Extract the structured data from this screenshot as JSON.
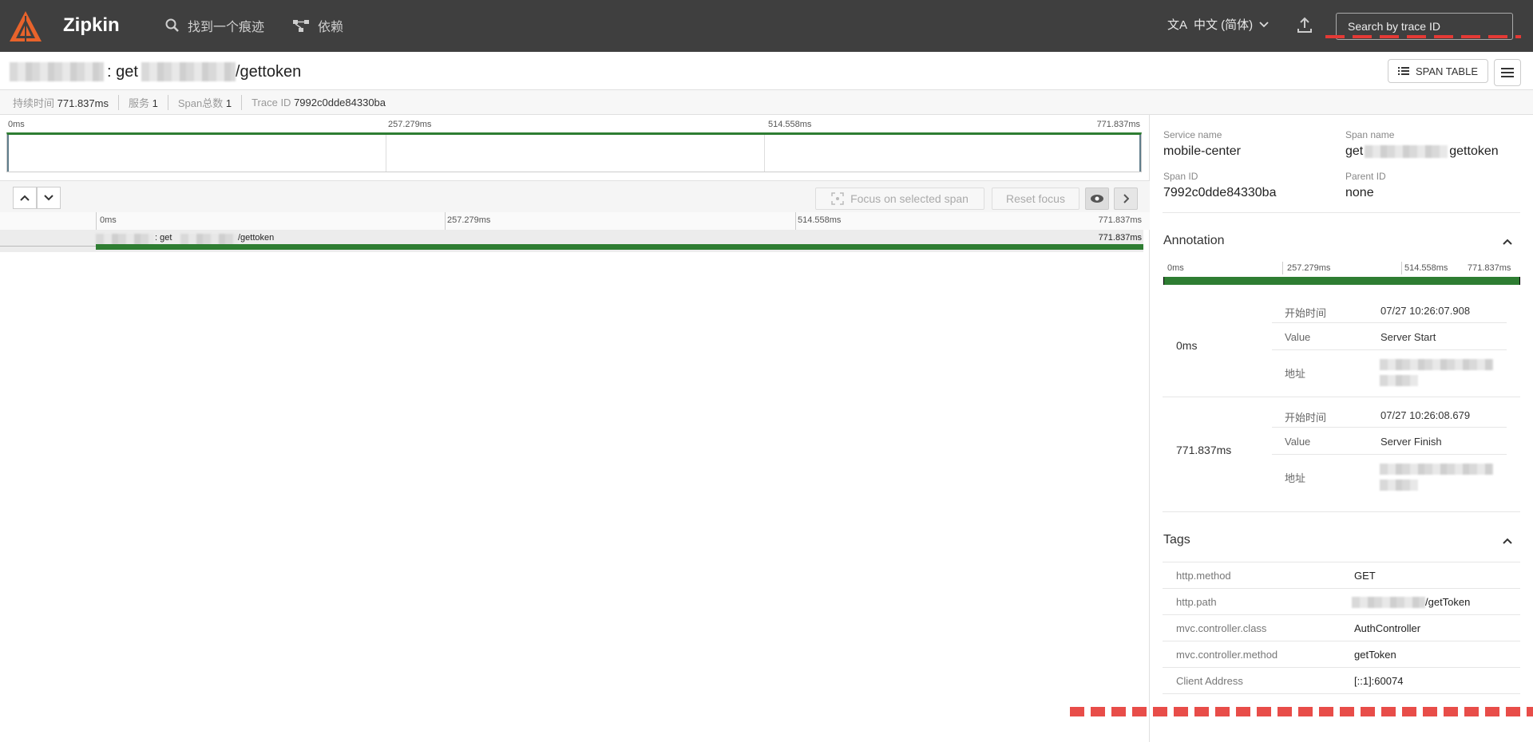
{
  "header": {
    "brand": "Zipkin",
    "nav": [
      {
        "label": "找到一个痕迹",
        "icon": "search-icon"
      },
      {
        "label": "依赖",
        "icon": "dependencies-icon"
      }
    ],
    "language": "中文 (简体)",
    "search_placeholder": "Search by trace ID"
  },
  "trace": {
    "title_mid": ": get",
    "title_end": "/gettoken",
    "span_table_label": "SPAN TABLE",
    "summary": {
      "duration_label": "持续时间",
      "duration_value": "771.837ms",
      "services_label": "服务",
      "services_value": "1",
      "spans_label": "Span总数",
      "spans_value": "1",
      "traceid_label": "Trace ID",
      "traceid_value": "7992c0dde84330ba"
    }
  },
  "timeline": {
    "ticks": [
      "0ms",
      "257.279ms",
      "514.558ms",
      "771.837ms"
    ],
    "focus_label": "Focus on selected span",
    "reset_label": "Reset focus",
    "span": {
      "name_mid": ": get",
      "name_end": "/gettoken",
      "duration": "771.837ms"
    }
  },
  "detail": {
    "service_name_label": "Service name",
    "service_name": "mobile-center",
    "span_name_label": "Span name",
    "span_name_prefix": "get",
    "span_name_suffix": "gettoken",
    "span_id_label": "Span ID",
    "span_id": "7992c0dde84330ba",
    "parent_id_label": "Parent ID",
    "parent_id": "none",
    "annotation_title": "Annotation",
    "annotation_ticks": [
      "0ms",
      "257.279ms",
      "514.558ms",
      "771.837ms"
    ],
    "annotations": [
      {
        "time": "0ms",
        "start_label": "开始时间",
        "start": "07/27 10:26:07.908",
        "value_label": "Value",
        "value": "Server Start",
        "addr_label": "地址"
      },
      {
        "time": "771.837ms",
        "start_label": "开始时间",
        "start": "07/27 10:26:08.679",
        "value_label": "Value",
        "value": "Server Finish",
        "addr_label": "地址"
      }
    ],
    "tags_title": "Tags",
    "tags": [
      {
        "key": "http.method",
        "value": "GET"
      },
      {
        "key": "http.path",
        "value": "/getToken"
      },
      {
        "key": "mvc.controller.class",
        "value": "AuthController"
      },
      {
        "key": "mvc.controller.method",
        "value": "getToken"
      },
      {
        "key": "Client Address",
        "value": "[::1]:60074"
      }
    ]
  },
  "colors": {
    "header_bg": "#3f3f3f",
    "span_bar": "#2e7d32",
    "logo": "#e8632b"
  }
}
